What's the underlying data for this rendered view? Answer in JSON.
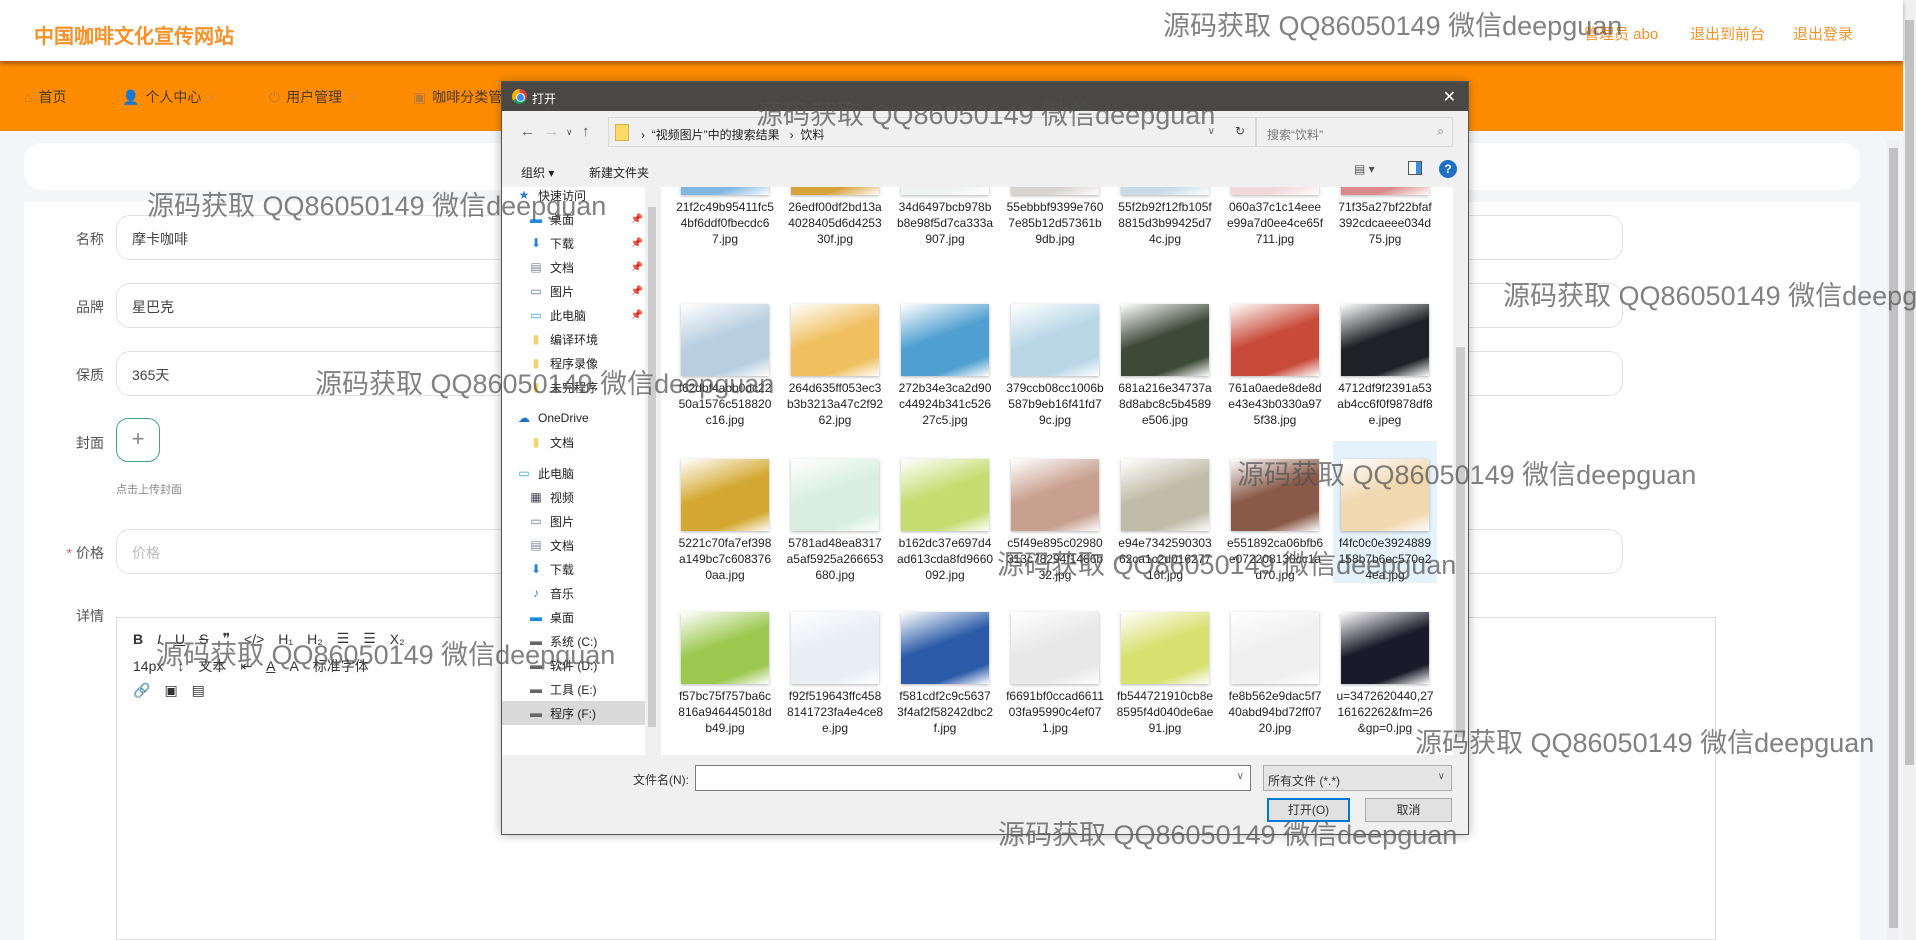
{
  "header": {
    "site_title": "中国咖啡文化宣传网站",
    "user": "管理员 abo",
    "to_front": "退出到前台",
    "logout": "退出登录"
  },
  "nav": [
    {
      "label": "首页",
      "icon": "home-icon"
    },
    {
      "label": "个人中心",
      "icon": "user-icon"
    },
    {
      "label": "用户管理",
      "icon": "power-icon"
    },
    {
      "label": "咖啡分类管",
      "icon": "category-icon"
    }
  ],
  "form": {
    "name_label": "名称",
    "name_value": "摩卡咖啡",
    "brand_label": "品牌",
    "brand_value": "星巴克",
    "shelf_label": "保质",
    "shelf_value": "365天",
    "cover_label": "封面",
    "cover_hint": "点击上传封面",
    "price_label": "价格",
    "price_placeholder": "价格",
    "detail_label": "详情",
    "editor": {
      "font_size": "14px",
      "block": "文本",
      "font": "标准字体"
    }
  },
  "dialog": {
    "title": "打开",
    "breadcrumb": [
      "“视频图片”中的搜索结果",
      "饮料"
    ],
    "search_placeholder": "搜索“饮料”",
    "organize": "组织 ▾",
    "new_folder": "新建文件夹",
    "nav_items": [
      {
        "label": "快速访问",
        "icon": "star-icon"
      },
      {
        "label": "桌面",
        "icon": "desktop-icon",
        "pinned": true
      },
      {
        "label": "下载",
        "icon": "download-icon",
        "pinned": true
      },
      {
        "label": "文档",
        "icon": "document-icon",
        "pinned": true
      },
      {
        "label": "图片",
        "icon": "picture-icon",
        "pinned": true
      },
      {
        "label": "此电脑",
        "icon": "computer-icon",
        "pinned": true
      },
      {
        "label": "编译环境",
        "icon": "folder-icon"
      },
      {
        "label": "程序录像",
        "icon": "folder-icon"
      },
      {
        "label": "未完程序",
        "icon": "folder-icon"
      },
      {
        "label": "OneDrive",
        "icon": "cloud-icon"
      },
      {
        "label": "文档",
        "icon": "folder-icon"
      },
      {
        "label": "此电脑",
        "icon": "computer-icon"
      },
      {
        "label": "视频",
        "icon": "video-icon"
      },
      {
        "label": "图片",
        "icon": "picture-icon"
      },
      {
        "label": "文档",
        "icon": "document-icon"
      },
      {
        "label": "下载",
        "icon": "download-icon"
      },
      {
        "label": "音乐",
        "icon": "music-icon"
      },
      {
        "label": "桌面",
        "icon": "desktop-icon"
      },
      {
        "label": "系统 (C:)",
        "icon": "drive-icon"
      },
      {
        "label": "软件 (D:)",
        "icon": "drive-icon"
      },
      {
        "label": "工具 (E:)",
        "icon": "drive-icon"
      },
      {
        "label": "程序 (F:)",
        "icon": "drive-icon",
        "selected": true
      }
    ],
    "files": [
      {
        "name": "21f2c49b95411fc54bf6ddf0fbecdc67.jpg",
        "color": "#7fb7e0"
      },
      {
        "name": "26edf00df2bd13a4028405d6d425330f.jpg",
        "color": "#d6a23a"
      },
      {
        "name": "34d6497bcb978bb8e98f5d7ca333a907.jpg",
        "color": "#eef2f0"
      },
      {
        "name": "55ebbbf9399e7607e85b12d57361b9db.jpg",
        "color": "#d9d2d0"
      },
      {
        "name": "55f2b92f12fb105f8815d3b99425d74c.jpg",
        "color": "#c9dbe8"
      },
      {
        "name": "060a37c1c14eeee99a7d0ee4ce65f711.jpg",
        "color": "#f2d8d8"
      },
      {
        "name": "71f35a27bf22bfaf392cdcaeee034d75.jpg",
        "color": "#d98a8a"
      },
      {
        "name": "f62dbf4abb0dc2250a1576c518820c16.jpg",
        "color": "#b9cfe0"
      },
      {
        "name": "264d635ff053ec3b3b3213a47c2f9262.jpg",
        "color": "#f0c060"
      },
      {
        "name": "272b34e3ca2d90c44924b341c52627c5.jpg",
        "color": "#4f9fd0"
      },
      {
        "name": "379ccb08cc1006b587b9eb16f41fd79c.jpg",
        "color": "#b8d6e6"
      },
      {
        "name": "681a216e34737a8d8abc8c5b4589e506.jpg",
        "color": "#3e4a38"
      },
      {
        "name": "761a0aede8de8de43e43b0330a975f38.jpg",
        "color": "#c84a3a"
      },
      {
        "name": "4712df9f2391a53ab4cc6f0f9878df8e.jpeg",
        "color": "#1e2226"
      },
      {
        "name": "5221c70fa7ef398a149bc7c6083760aa.jpg",
        "color": "#d4a830"
      },
      {
        "name": "5781ad48ea8317a5af5925a266653680.jpg",
        "color": "#d8efe0"
      },
      {
        "name": "b162dc37e697d4ad613cda8fd9660092.jpg",
        "color": "#c6dc70"
      },
      {
        "name": "c5f49e895c02980313c78294f1466b32.jpg",
        "color": "#c8a090"
      },
      {
        "name": "e94e734259030362ca1c2d01627716f.jpg",
        "color": "#c0bca8"
      },
      {
        "name": "e551892ca06bfb6e072208130cc1ad70.jpg",
        "color": "#8a5a48"
      },
      {
        "name": "f4fc0c0e3924889158b7b6ec570e24ea.jpg",
        "color": "#f0d8b0",
        "selected": true
      },
      {
        "name": "f57bc75f757ba6c816a946445018db49.jpg",
        "color": "#9cc850"
      },
      {
        "name": "f92f519643ffc4588141723fa4e4ce8e.jpg",
        "color": "#e8eef4"
      },
      {
        "name": "f581cdf2c9c56373f4af2f58242dbc2f.jpg",
        "color": "#2a5aa8"
      },
      {
        "name": "f6691bf0ccad661103fa95990c4ef071.jpg",
        "color": "#e8e8e8"
      },
      {
        "name": "fb544721910cb8e8595f4d040de6ae91.jpg",
        "color": "#d8e070"
      },
      {
        "name": "fe8b562e9dac5f740abd94bd72ff0720.jpg",
        "color": "#f0f0f0"
      },
      {
        "name": "u=3472620440,2716162262&fm=26&gp=0.jpg",
        "color": "#1a1a2a"
      }
    ],
    "filename_label": "文件名(N):",
    "filename_value": "",
    "filter": "所有文件 (*.*)",
    "open": "打开(O)",
    "cancel": "取消"
  },
  "watermark": "源码获取 QQ86050149 微信deepguan",
  "colors": {
    "accent": "#ff8c00",
    "title": "#f5922a",
    "upload_border": "#3fa592"
  }
}
